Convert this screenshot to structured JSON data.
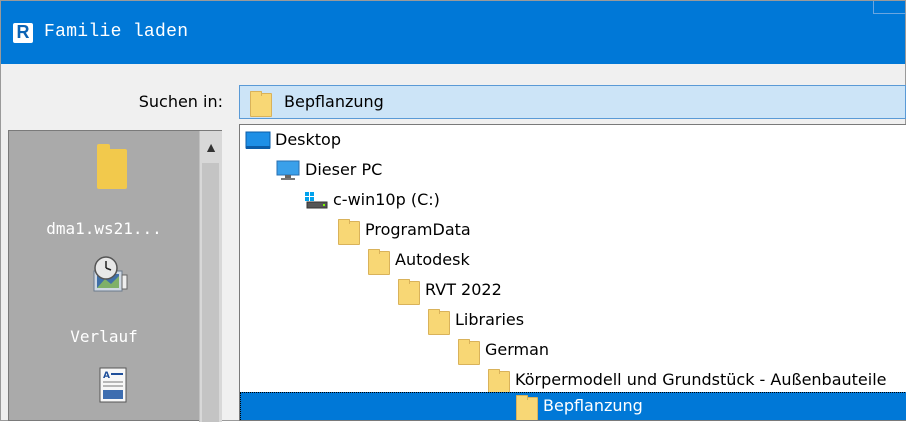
{
  "window": {
    "title": "Familie laden",
    "logo_letter": "R",
    "accent": "#0078d7"
  },
  "look_in": {
    "label": "Suchen in:",
    "value": "Bepflanzung"
  },
  "places": [
    {
      "label": "dma1.ws21...",
      "icon": "folder-icon"
    },
    {
      "label": "Verlauf",
      "icon": "recent-history-icon"
    },
    {
      "label": "",
      "icon": "document-icon"
    }
  ],
  "tree": [
    {
      "label": "Desktop",
      "icon": "desktop-icon",
      "level": 0
    },
    {
      "label": "Dieser PC",
      "icon": "computer-icon",
      "level": 1
    },
    {
      "label": "c-win10p (C:)",
      "icon": "drive-icon",
      "level": 2
    },
    {
      "label": "ProgramData",
      "icon": "folder-icon",
      "level": 3
    },
    {
      "label": "Autodesk",
      "icon": "folder-icon",
      "level": 4
    },
    {
      "label": "RVT 2022",
      "icon": "folder-icon",
      "level": 5
    },
    {
      "label": "Libraries",
      "icon": "folder-icon",
      "level": 6
    },
    {
      "label": "German",
      "icon": "folder-icon",
      "level": 7
    },
    {
      "label": "Körpermodell und Grundstück - Außenbauteile",
      "icon": "folder-icon",
      "level": 8
    },
    {
      "label": "Bepflanzung",
      "icon": "folder-icon",
      "level": 9,
      "selected": true
    }
  ]
}
